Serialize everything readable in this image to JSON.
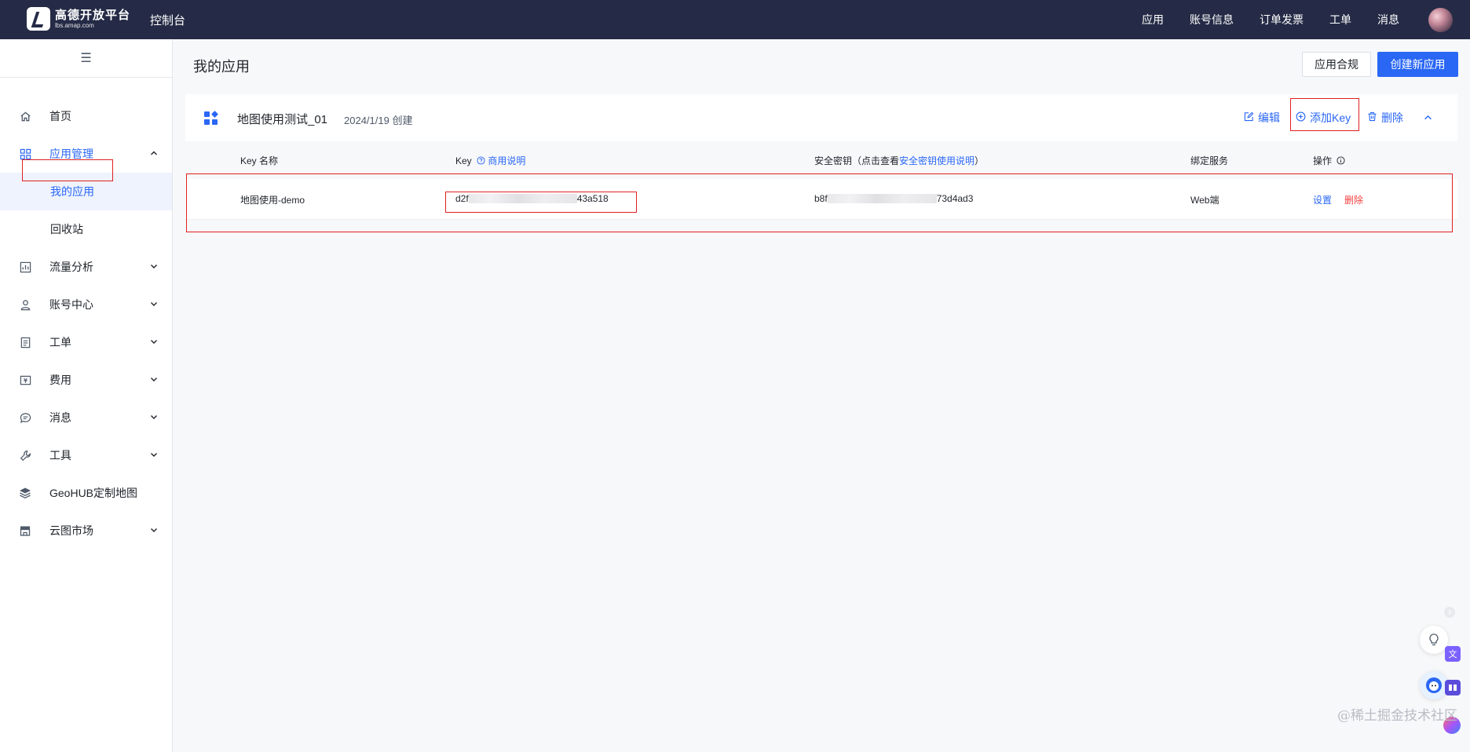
{
  "topbar": {
    "logo_text": "高德开放平台",
    "logo_sub": "lbs.amap.com",
    "console_title": "控制台",
    "nav": [
      "应用",
      "账号信息",
      "订单发票",
      "工单",
      "消息"
    ]
  },
  "sidebar": {
    "collapse_icon": "☰",
    "items": [
      {
        "label": "首页",
        "icon": "home-icon"
      },
      {
        "label": "应用管理",
        "icon": "grid-icon"
      },
      {
        "label": "我的应用"
      },
      {
        "label": "回收站"
      },
      {
        "label": "流量分析",
        "icon": "chart-icon"
      },
      {
        "label": "账号中心",
        "icon": "user-icon"
      },
      {
        "label": "工单",
        "icon": "ticket-icon"
      },
      {
        "label": "费用",
        "icon": "fee-icon"
      },
      {
        "label": "消息",
        "icon": "message-icon"
      },
      {
        "label": "工具",
        "icon": "wrench-icon"
      },
      {
        "label": "GeoHUB定制地图",
        "icon": "layers-icon"
      },
      {
        "label": "云图市场",
        "icon": "store-icon"
      }
    ]
  },
  "main": {
    "page_title": "我的应用",
    "compliance_label": "应用合规",
    "create_label": "创建新应用"
  },
  "app": {
    "name": "地图使用测试_01",
    "created": "2024/1/19 创建",
    "edit_label": "编辑",
    "add_key_label": "添加Key",
    "delete_label": "删除"
  },
  "table": {
    "headers": {
      "key_name": "Key 名称",
      "key": "Key",
      "key_link": "商用说明",
      "secret_prefix": "安全密钥（点击查看",
      "secret_link": "安全密钥使用说明",
      "secret_suffix": "）",
      "service": "绑定服务",
      "ops": "操作"
    },
    "rows": [
      {
        "name": "地图使用-demo",
        "key_start": "d2f",
        "key_end": "43a518",
        "secret_start": "b8f",
        "secret_end": "73d4ad3",
        "service": "Web端",
        "op_set": "设置",
        "op_delete": "删除"
      }
    ]
  },
  "watermark": "@稀土掘金技术社区",
  "colors": {
    "topbar": "#252b46",
    "accent": "#2a67f5",
    "danger": "#f53f3f",
    "highlight": "#e02020"
  }
}
